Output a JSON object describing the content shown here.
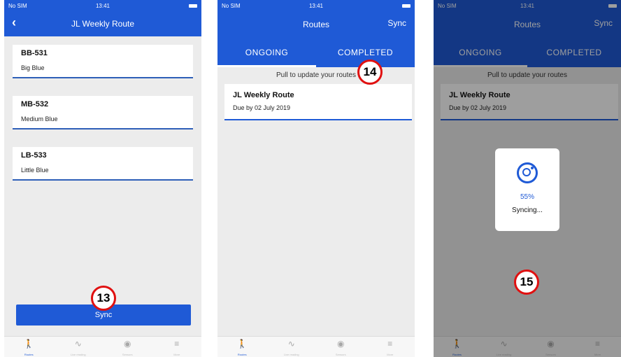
{
  "screen1": {
    "status": {
      "carrier": "No SIM",
      "time": "13:41"
    },
    "nav": {
      "title": "JL Weekly Route"
    },
    "items": [
      {
        "code": "BB-531",
        "name": "Big Blue"
      },
      {
        "code": "MB-532",
        "name": "Medium Blue"
      },
      {
        "code": "LB-533",
        "name": "Little Blue"
      }
    ],
    "sync_button": "Sync",
    "tabbar": [
      "Routes",
      "Live reading",
      "Sensors",
      "More"
    ]
  },
  "screen2": {
    "status": {
      "carrier": "No SIM",
      "time": "13:41"
    },
    "nav": {
      "title": "Routes",
      "right": "Sync"
    },
    "tabs": [
      "ONGOING",
      "COMPLETED"
    ],
    "pull_text": "Pull to update your routes",
    "route": {
      "title": "JL Weekly Route",
      "due": "Due by 02 July 2019"
    },
    "tabbar": [
      "Routes",
      "Live reading",
      "Sensors",
      "More"
    ]
  },
  "screen3": {
    "status": {
      "carrier": "No SIM",
      "time": "13:41"
    },
    "nav": {
      "title": "Routes",
      "right": "Sync"
    },
    "tabs": [
      "ONGOING",
      "COMPLETED"
    ],
    "pull_text": "Pull to update your routes",
    "route": {
      "title": "JL Weekly Route",
      "due": "Due by 02 July 2019"
    },
    "dialog": {
      "progress": "55%",
      "text": "Syncing..."
    },
    "tabbar": [
      "Routes",
      "Live reading",
      "Sensors",
      "More"
    ]
  },
  "markers": [
    "13",
    "14",
    "15"
  ],
  "colors": {
    "brand": "#1f5ad6",
    "marker": "#e01010"
  }
}
